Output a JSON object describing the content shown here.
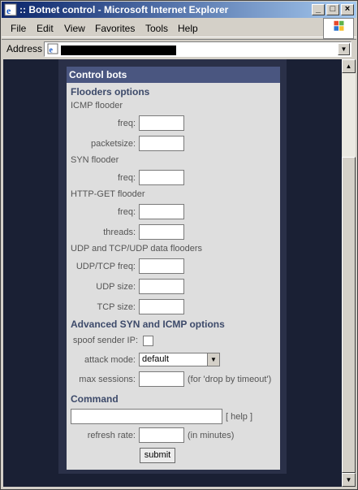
{
  "window": {
    "title": ":: Botnet control - Microsoft Internet Explorer",
    "minimize_glyph": "_",
    "maximize_glyph": "□",
    "close_glyph": "×"
  },
  "menu": {
    "items": [
      "File",
      "Edit",
      "View",
      "Favorites",
      "Tools",
      "Help"
    ]
  },
  "address": {
    "label": "Address",
    "url": ""
  },
  "panel": {
    "header": "Control bots",
    "floaders_title": "Flooders options",
    "icmp": {
      "title": "ICMP flooder",
      "freq_label": "freq:",
      "packetsize_label": "packetsize:"
    },
    "syn": {
      "title": "SYN flooder",
      "freq_label": "freq:"
    },
    "http": {
      "title": "HTTP-GET flooder",
      "freq_label": "freq:",
      "threads_label": "threads:"
    },
    "udp": {
      "title": "UDP and TCP/UDP data flooders",
      "udptcp_freq_label": "UDP/TCP freq:",
      "udp_size_label": "UDP size:",
      "tcp_size_label": "TCP size:"
    },
    "advanced": {
      "title": "Advanced SYN and ICMP options",
      "spoof_label": "spoof sender IP:",
      "spoof_checked": false,
      "attack_mode_label": "attack mode:",
      "attack_mode_value": "default",
      "max_sessions_label": "max sessions:",
      "max_sessions_note": "(for 'drop by timeout')"
    },
    "command": {
      "title": "Command",
      "help_note": "[ help ]",
      "refresh_label": "refresh rate:",
      "refresh_note": "(in minutes)",
      "submit_label": "submit"
    }
  },
  "colors": {
    "title_gradient_start": "#0a246a",
    "page_background": "#1a2034",
    "panel_header": "#4a5680",
    "section_title": "#3d4a6a"
  }
}
